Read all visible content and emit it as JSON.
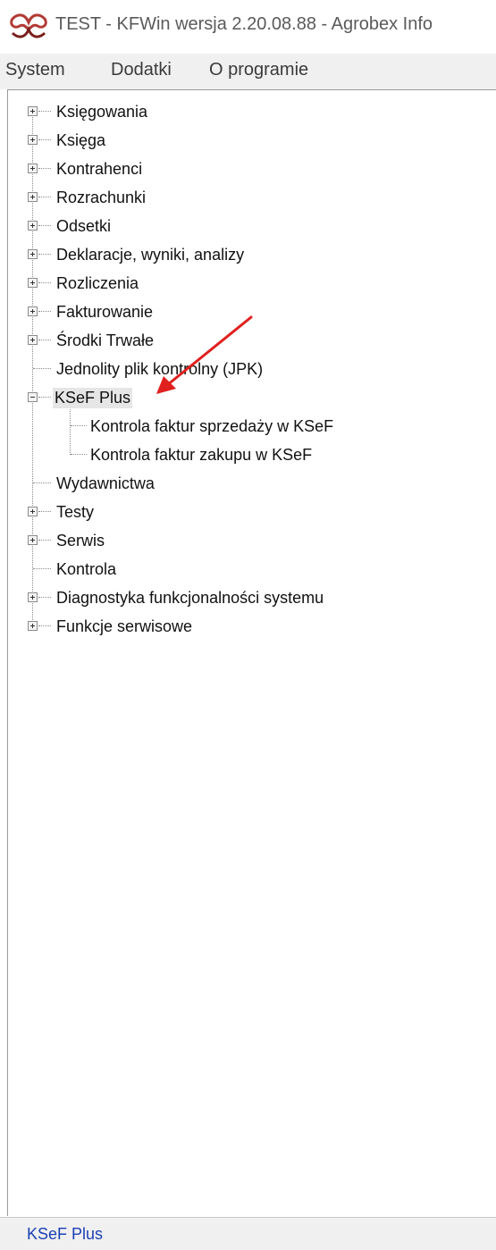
{
  "window": {
    "title": "TEST - KFWin wersja 2.20.08.88 - Agrobex Info",
    "app_icon": "kfwin-logo-icon"
  },
  "menu": {
    "items": [
      "System",
      "Dodatki",
      "O programie"
    ]
  },
  "tree": {
    "nodes": [
      {
        "label": "Księgowania",
        "expander": "plus"
      },
      {
        "label": "Księga",
        "expander": "plus"
      },
      {
        "label": "Kontrahenci",
        "expander": "plus"
      },
      {
        "label": "Rozrachunki",
        "expander": "plus"
      },
      {
        "label": "Odsetki",
        "expander": "plus"
      },
      {
        "label": "Deklaracje, wyniki, analizy",
        "expander": "plus"
      },
      {
        "label": "Rozliczenia",
        "expander": "plus"
      },
      {
        "label": "Fakturowanie",
        "expander": "plus"
      },
      {
        "label": "Środki Trwałe",
        "expander": "plus"
      },
      {
        "label": "Jednolity plik kontrolny (JPK)",
        "expander": "none"
      },
      {
        "label": "KSeF Plus",
        "expander": "minus",
        "selected": true,
        "children": [
          {
            "label": "Kontrola faktur sprzedaży w KSeF"
          },
          {
            "label": "Kontrola faktur zakupu w KSeF"
          }
        ]
      },
      {
        "label": "Wydawnictwa",
        "expander": "none"
      },
      {
        "label": "Testy",
        "expander": "plus"
      },
      {
        "label": "Serwis",
        "expander": "plus"
      },
      {
        "label": "Kontrola",
        "expander": "none"
      },
      {
        "label": "Diagnostyka funkcjonalności systemu",
        "expander": "plus"
      },
      {
        "label": "Funkcje serwisowe",
        "expander": "plus"
      }
    ]
  },
  "annotation": {
    "arrow_color": "#e0201e"
  },
  "status": {
    "text": "KSeF Plus",
    "color": "#1b3fb5"
  }
}
